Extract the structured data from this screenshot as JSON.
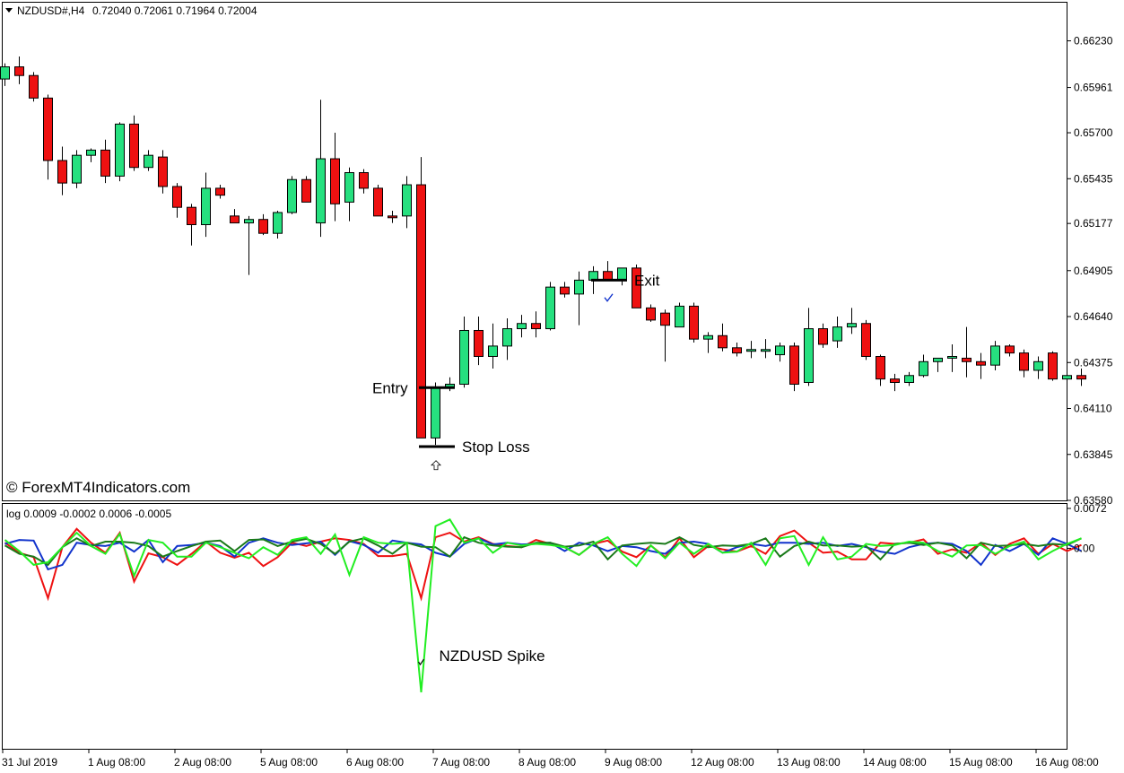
{
  "header": {
    "symbol_label": "NZDUSD#,H4",
    "ohlc": "0.72040 0.72061 0.71964 0.72004",
    "indicator_label": "log 0.0009 -0.0002 0.0006 -0.0005"
  },
  "watermark": "© ForexMT4Indicators.com",
  "colors": {
    "bull": "#26e07f",
    "bear": "#ee1111",
    "series_red": "#ee1111",
    "series_blue": "#1133cc",
    "series_darkgreen": "#1a7a1a",
    "series_lime": "#22ee22"
  },
  "chart_data": [
    {
      "type": "candlestick",
      "title": "NZDUSD#,H4",
      "ylim": [
        0.6358,
        0.6645
      ],
      "y_ticks": [
        "0.66230",
        "0.65961",
        "0.65700",
        "0.65435",
        "0.65177",
        "0.64905",
        "0.64640",
        "0.64375",
        "0.64110",
        "0.63845",
        "0.63580"
      ],
      "x_ticks": [
        "31 Jul 2019",
        "1 Aug 08:00",
        "2 Aug 08:00",
        "5 Aug 08:00",
        "6 Aug 08:00",
        "7 Aug 08:00",
        "8 Aug 08:00",
        "9 Aug 08:00",
        "12 Aug 08:00",
        "13 Aug 08:00",
        "14 Aug 08:00",
        "15 Aug 08:00",
        "16 Aug 08:00"
      ],
      "candles": [
        [
          0.6601,
          0.661,
          0.6597,
          0.6608
        ],
        [
          0.6608,
          0.6614,
          0.6598,
          0.6603
        ],
        [
          0.6603,
          0.6605,
          0.6588,
          0.659
        ],
        [
          0.659,
          0.6592,
          0.6543,
          0.6554
        ],
        [
          0.6554,
          0.6562,
          0.6534,
          0.6541
        ],
        [
          0.6541,
          0.656,
          0.6538,
          0.6557
        ],
        [
          0.6557,
          0.6561,
          0.6553,
          0.656
        ],
        [
          0.656,
          0.6566,
          0.6541,
          0.6545
        ],
        [
          0.6545,
          0.6576,
          0.6542,
          0.6575
        ],
        [
          0.6575,
          0.658,
          0.6548,
          0.655
        ],
        [
          0.655,
          0.656,
          0.6548,
          0.6557
        ],
        [
          0.6556,
          0.656,
          0.6535,
          0.6539
        ],
        [
          0.6539,
          0.6541,
          0.6521,
          0.6527
        ],
        [
          0.6527,
          0.6529,
          0.6505,
          0.6517
        ],
        [
          0.6517,
          0.6547,
          0.651,
          0.6538
        ],
        [
          0.6538,
          0.654,
          0.6532,
          0.6534
        ],
        [
          0.6522,
          0.6526,
          0.6518,
          0.6518
        ],
        [
          0.6518,
          0.6522,
          0.6488,
          0.652
        ],
        [
          0.652,
          0.6523,
          0.6511,
          0.6512
        ],
        [
          0.6512,
          0.6525,
          0.6509,
          0.6524
        ],
        [
          0.6524,
          0.6545,
          0.6523,
          0.6543
        ],
        [
          0.6543,
          0.6545,
          0.653,
          0.653
        ],
        [
          0.6518,
          0.6589,
          0.651,
          0.6555
        ],
        [
          0.6555,
          0.657,
          0.6519,
          0.6529
        ],
        [
          0.653,
          0.655,
          0.6519,
          0.6547
        ],
        [
          0.6547,
          0.6549,
          0.6535,
          0.6538
        ],
        [
          0.6538,
          0.654,
          0.6522,
          0.6522
        ],
        [
          0.6522,
          0.6525,
          0.6518,
          0.6521
        ],
        [
          0.6522,
          0.6545,
          0.6515,
          0.654
        ],
        [
          0.654,
          0.6556,
          0.6394,
          0.6394
        ],
        [
          0.6394,
          0.6426,
          0.639,
          0.6423
        ],
        [
          0.6423,
          0.6429,
          0.6421,
          0.6425
        ],
        [
          0.6425,
          0.6464,
          0.6423,
          0.6456
        ],
        [
          0.6456,
          0.6464,
          0.6436,
          0.6441
        ],
        [
          0.6441,
          0.646,
          0.6434,
          0.6447
        ],
        [
          0.6447,
          0.6463,
          0.6439,
          0.6457
        ],
        [
          0.6457,
          0.6465,
          0.6452,
          0.646
        ],
        [
          0.646,
          0.6467,
          0.6452,
          0.6457
        ],
        [
          0.6457,
          0.6484,
          0.6456,
          0.6481
        ],
        [
          0.6481,
          0.6484,
          0.6475,
          0.6477
        ],
        [
          0.6477,
          0.649,
          0.6459,
          0.6485
        ],
        [
          0.6485,
          0.6493,
          0.6477,
          0.649
        ],
        [
          0.649,
          0.6496,
          0.6485,
          0.6485
        ],
        [
          0.6485,
          0.6492,
          0.6482,
          0.6492
        ],
        [
          0.6492,
          0.6494,
          0.6469,
          0.6469
        ],
        [
          0.6469,
          0.6471,
          0.6461,
          0.6462
        ],
        [
          0.6466,
          0.6468,
          0.6438,
          0.6459
        ],
        [
          0.6458,
          0.6472,
          0.6458,
          0.647
        ],
        [
          0.647,
          0.6472,
          0.6449,
          0.6451
        ],
        [
          0.6451,
          0.6455,
          0.6443,
          0.6453
        ],
        [
          0.6453,
          0.646,
          0.6444,
          0.6446
        ],
        [
          0.6446,
          0.6449,
          0.6441,
          0.6443
        ],
        [
          0.6444,
          0.645,
          0.644,
          0.6445
        ],
        [
          0.6444,
          0.6451,
          0.644,
          0.6445
        ],
        [
          0.6442,
          0.6449,
          0.6438,
          0.6447
        ],
        [
          0.6447,
          0.6449,
          0.6421,
          0.6425
        ],
        [
          0.6426,
          0.6469,
          0.6424,
          0.6457
        ],
        [
          0.6457,
          0.646,
          0.6446,
          0.6448
        ],
        [
          0.645,
          0.6464,
          0.6446,
          0.6458
        ],
        [
          0.6458,
          0.6469,
          0.6454,
          0.646
        ],
        [
          0.646,
          0.6462,
          0.6439,
          0.6441
        ],
        [
          0.6441,
          0.6442,
          0.6424,
          0.6428
        ],
        [
          0.6428,
          0.6431,
          0.6421,
          0.6426
        ],
        [
          0.6426,
          0.6432,
          0.6424,
          0.643
        ],
        [
          0.643,
          0.6442,
          0.6429,
          0.6438
        ],
        [
          0.6438,
          0.644,
          0.6432,
          0.644
        ],
        [
          0.644,
          0.6448,
          0.6432,
          0.6441
        ],
        [
          0.644,
          0.6458,
          0.6429,
          0.6438
        ],
        [
          0.6438,
          0.6443,
          0.6428,
          0.6436
        ],
        [
          0.6436,
          0.645,
          0.6433,
          0.6447
        ],
        [
          0.6447,
          0.6448,
          0.6441,
          0.6443
        ],
        [
          0.6443,
          0.6445,
          0.6429,
          0.6433
        ],
        [
          0.6433,
          0.6441,
          0.6428,
          0.6438
        ],
        [
          0.6443,
          0.6444,
          0.6427,
          0.6428
        ],
        [
          0.6428,
          0.6435,
          0.6423,
          0.643
        ],
        [
          0.643,
          0.6434,
          0.6424,
          0.6428
        ]
      ],
      "annotations": [
        {
          "text": "Entry",
          "price": 0.6423,
          "bar_start": 29,
          "bar_end": 31
        },
        {
          "text": "Stop Loss",
          "price": 0.6389,
          "bar_start": 29,
          "bar_end": 31
        },
        {
          "text": "Exit",
          "price": 0.6485,
          "bar_start": 41,
          "bar_end": 43
        }
      ]
    },
    {
      "type": "line",
      "title": "log",
      "values_shown": [
        "0.0009",
        "-0.0002",
        "0.0006",
        "-0.0005"
      ],
      "ylim": [
        -0.0362,
        0.008
      ],
      "y_ticks": [
        "0.0072",
        "0.00"
      ],
      "annotations": [
        {
          "text": "NZDUSD Spike",
          "series": "lime",
          "index": 29
        }
      ],
      "series": [
        {
          "key": "red",
          "values": [
            0.001,
            -0.0008,
            -0.0016,
            -0.009,
            0.0002,
            0.0035,
            0.001,
            -0.0008,
            0.0028,
            -0.006,
            -0.0009,
            -0.0016,
            -0.003,
            -0.001,
            0.0012,
            -0.0008,
            -0.0017,
            -0.0008,
            -0.0032,
            -0.0016,
            0.001,
            0.0004,
            0.0012,
            0.0018,
            0.0015,
            0.0008,
            -0.0014,
            -0.0014,
            -0.001,
            -0.009,
            0.002,
            0.0028,
            0.0012,
            0.002,
            0.0008,
            0.0004,
            0.0002,
            0.0015,
            0.0008,
            0.0002,
            -0.0012,
            0.0008,
            0.0014,
            -0.0006,
            -0.0016,
            0.0005,
            -0.0016,
            0.0018,
            -0.0016,
            0.0004,
            -0.0002,
            -0.0006,
            0.0004,
            -0.001,
            0.0022,
            0.0032,
            0.001,
            -0.0008,
            -0.0006,
            -0.002,
            -0.002,
            0.001,
            0.0008,
            0.001,
            0.0016,
            -0.001,
            -0.0002,
            -0.0008,
            0.001,
            -0.0012,
            0.0008,
            0.0018,
            -0.001,
            0.0008,
            -0.0005,
            0.0006
          ]
        },
        {
          "key": "blue",
          "values": [
            0.0008,
            0.0015,
            0.0014,
            -0.0038,
            -0.003,
            0.001,
            0.0006,
            0.0004,
            0.001,
            -0.0006,
            0.0015,
            -0.0025,
            0.0004,
            0.0006,
            0.001,
            0.0004,
            -0.0015,
            0.001,
            0.0018,
            0.001,
            0.0006,
            0.0009,
            0.0012,
            -0.0012,
            0.0013,
            0.0006,
            -0.0008,
            0.0014,
            0.001,
            0.0007,
            -0.0008,
            -0.0015,
            0.0008,
            0.0018,
            0.0007,
            0.001,
            0.0007,
            0.0008,
            0.001,
            -0.0005,
            0.001,
            0.0005,
            -0.0005,
            0.0004,
            0.0002,
            -0.0005,
            -0.001,
            0.001,
            0.0012,
            0.0008,
            -0.0008,
            0.0002,
            0.0008,
            0.0004,
            0.001,
            0.001,
            0.0008,
            0.001,
            0.0004,
            0.0008,
            0.0002,
            -0.0006,
            -0.001,
            0.0002,
            0.0008,
            0.001,
            0.0008,
            -0.0005,
            -0.003,
            0.0006,
            -0.0005,
            0.0008,
            -0.0012,
            0.0018,
            0.0008,
            -0.0005
          ]
        },
        {
          "key": "darkgreen",
          "values": [
            0.0005,
            -0.001,
            -0.0015,
            -0.003,
            0.0002,
            0.0018,
            0.0004,
            0.0012,
            0.0012,
            0.001,
            0.0004,
            -0.0015,
            -0.0005,
            0.0004,
            0.0012,
            0.0014,
            -0.0005,
            0.0015,
            0.0016,
            0.0004,
            0.0012,
            0.0017,
            0.0008,
            -0.001,
            0.0012,
            0.0018,
            0.0005,
            -0.001,
            0.001,
            0.0003,
            0.0002,
            -0.0015,
            0.002,
            0.001,
            0.0005,
            0.0003,
            0.0002,
            0.001,
            0.001,
            0.0003,
            0.0005,
            0.0012,
            -0.002,
            0.0005,
            0.0008,
            0.001,
            0.0008,
            0.002,
            0.0006,
            0.0002,
            0.0005,
            0.0004,
            0.0008,
            0.0018,
            -0.0015,
            0.0004,
            0.0012,
            0.0005,
            0.0005,
            0.0003,
            0.0004,
            -0.002,
            0.0008,
            0.001,
            0.0006,
            0.001,
            0.0005,
            -0.0018,
            0.001,
            0.0004,
            0.0005,
            0.0008,
            0.0004,
            0.0008,
            0.0006,
            0.0018
          ]
        },
        {
          "key": "lime",
          "values": [
            0.0015,
            -0.0005,
            -0.003,
            -0.0025,
            0.0002,
            0.0028,
            0.0004,
            -0.001,
            0.0026,
            -0.005,
            0.0015,
            0.001,
            -0.0015,
            -0.0015,
            0.001,
            0.0002,
            -0.0008,
            -0.0018,
            0.0002,
            -0.0012,
            0.0015,
            0.002,
            -0.001,
            0.0025,
            -0.0048,
            0.002,
            0.001,
            0.0008,
            0.001,
            -0.026,
            0.004,
            0.0052,
            0.001,
            0.0018,
            -0.0008,
            0.001,
            0.0005,
            0.0008,
            0.0006,
            0.0002,
            -0.0012,
            0.0008,
            0.002,
            -0.001,
            -0.0032,
            0.0005,
            -0.0018,
            0.001,
            -0.001,
            0.0008,
            -0.0008,
            -0.0006,
            0.001,
            -0.003,
            0.0018,
            0.0022,
            -0.003,
            0.002,
            -0.002,
            -0.0015,
            0.0008,
            0.0004,
            0.0006,
            0.0012,
            0.001,
            -0.0005,
            -0.0015,
            0.0005,
            0.0006,
            -0.001,
            0.0004,
            0.0012,
            -0.002,
            -0.0005,
            0.0008,
            0.0018
          ]
        }
      ]
    }
  ]
}
